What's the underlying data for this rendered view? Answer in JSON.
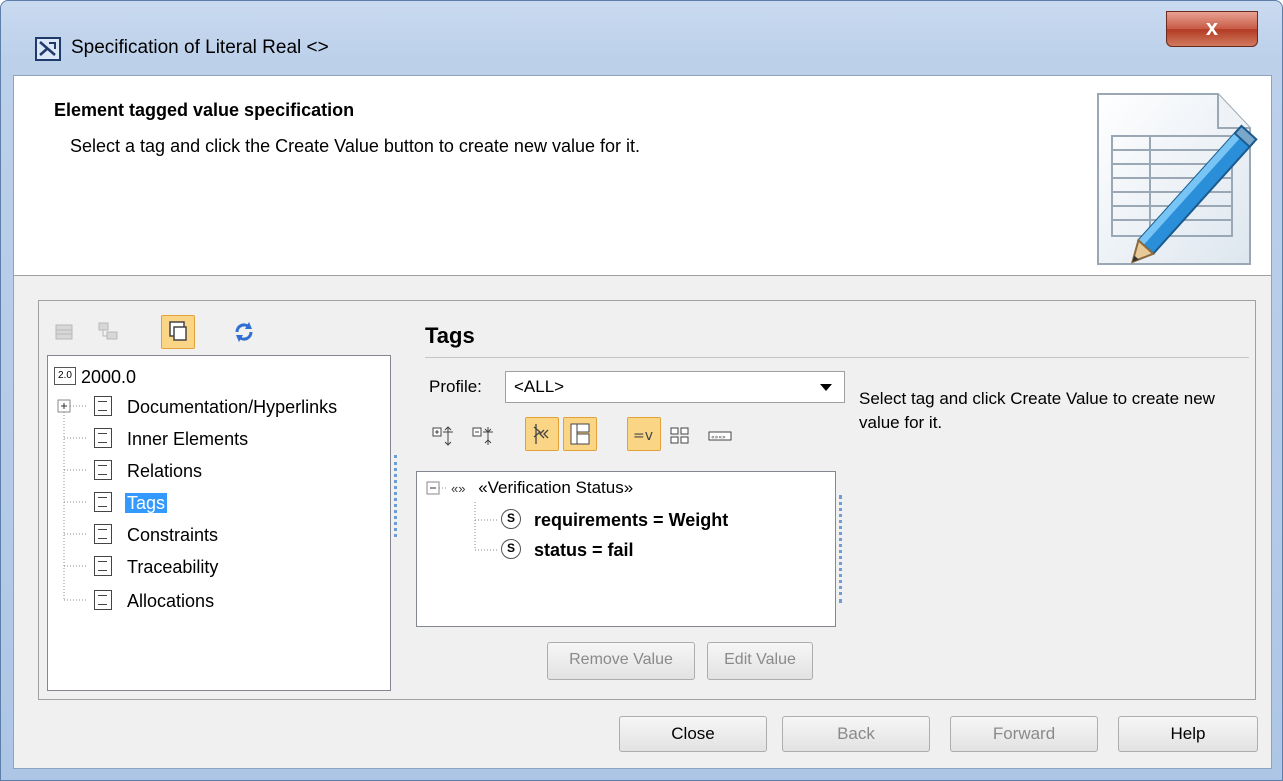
{
  "window": {
    "title": "Specification of Literal Real <>",
    "close_glyph": "x"
  },
  "header": {
    "title": "Element tagged value specification",
    "description": "Select a tag and click the Create Value button to create new value for it."
  },
  "tree": {
    "root": {
      "label": "2000.0",
      "icon_text": "2.0"
    },
    "items": [
      {
        "label": "Documentation/Hyperlinks",
        "expandable": true,
        "selected": false
      },
      {
        "label": "Inner Elements",
        "selected": false
      },
      {
        "label": "Relations",
        "selected": false
      },
      {
        "label": "Tags",
        "selected": true
      },
      {
        "label": "Constraints",
        "selected": false
      },
      {
        "label": "Traceability",
        "selected": false
      },
      {
        "label": "Allocations",
        "selected": false
      }
    ]
  },
  "tags_panel": {
    "title": "Tags",
    "profile_label": "Profile:",
    "profile_value": "<ALL>",
    "hint": "Select tag and click Create Value to create new value for it.",
    "stereotype": {
      "glyph": "«»",
      "label": "«Verification Status»"
    },
    "tags": [
      {
        "text": "requirements = Weight",
        "icon": "S"
      },
      {
        "text": "status = fail",
        "icon": "S"
      }
    ],
    "remove_value": "Remove Value",
    "edit_value": "Edit Value"
  },
  "footer": {
    "close": "Close",
    "back": "Back",
    "forward": "Forward",
    "help": "Help"
  },
  "colors": {
    "selection": "#3399ff",
    "active_toggle": "#fbd586",
    "dotted_guide": "#6d9dd6"
  }
}
